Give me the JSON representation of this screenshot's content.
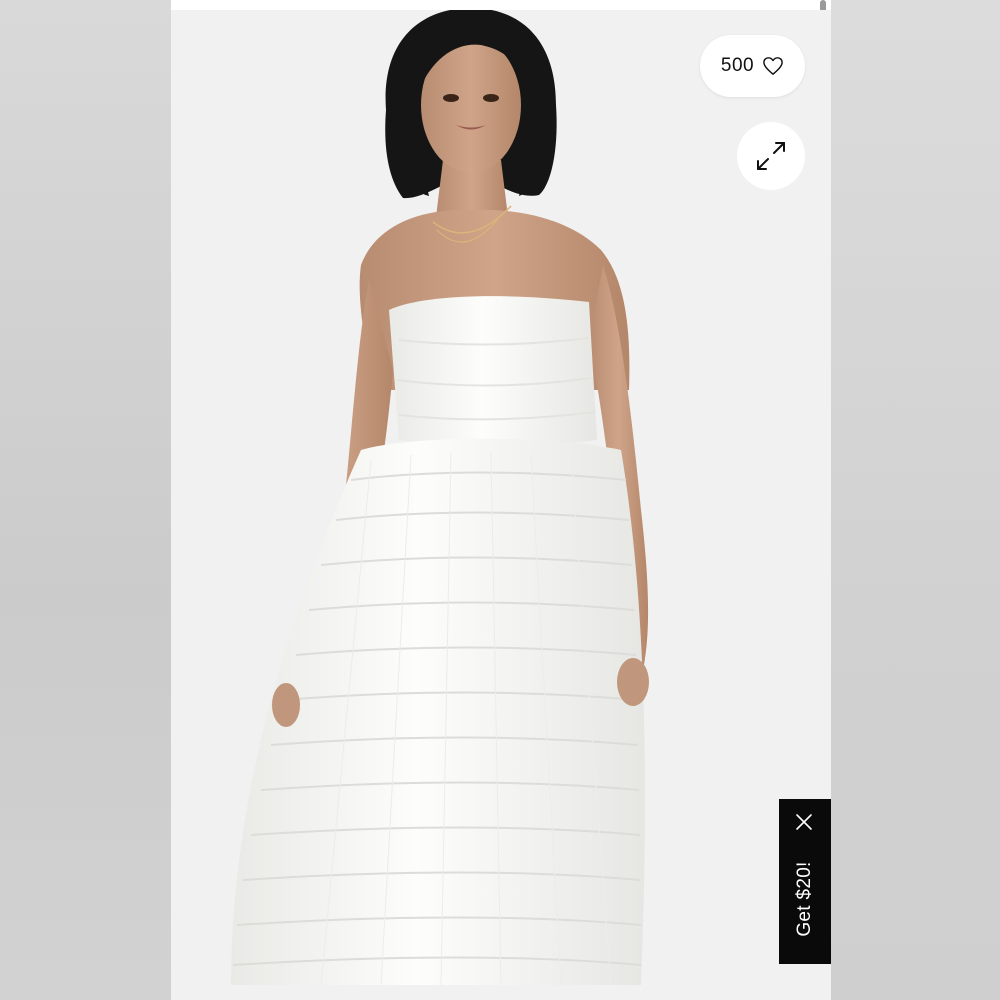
{
  "wishlist": {
    "count": "500",
    "icon": "heart-icon"
  },
  "viewer": {
    "expand_icon": "expand-icon"
  },
  "promo": {
    "label": "Get $20!",
    "close_icon": "close-icon"
  },
  "colors": {
    "background": "#f1f1f1",
    "promo_bg": "#0a0a0a",
    "button_bg": "#ffffff",
    "dress": "#fbfbf9"
  }
}
